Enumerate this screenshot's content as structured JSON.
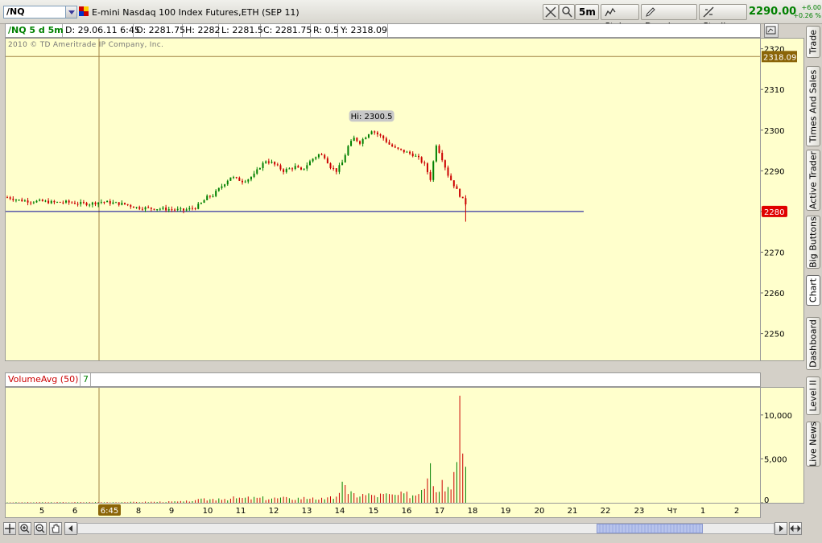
{
  "toolbar": {
    "symbol": "/NQ",
    "instrument_desc": "E-mini Nasdaq 100 Index Futures,ETH (SEP 11)",
    "timeframe_label": "5m",
    "style_label": "Style",
    "drawings_label": "Drawings",
    "studies_label": "Studies",
    "last_price": "2290.00",
    "change_abs": "+6.00",
    "change_pct": "+0.26 %"
  },
  "info_bar": {
    "symbol_period": "/NQ 5 d 5m",
    "date": "D: 29.06.11 6:45",
    "open": "O: 2281.75",
    "high": "H: 2282",
    "low": "L: 2281.5",
    "close": "C: 2281.75",
    "range": "R: 0.5",
    "y": "Y: 2318.09"
  },
  "copyright": "2010 © TD Ameritrade IP Company, Inc.",
  "volume_bar": {
    "study_label": "VolumeAvg (50)",
    "value": "7"
  },
  "side_tabs": [
    "Trade",
    "Times And Sales",
    "Active Trader",
    "Big Buttons",
    "Chart",
    "Dashboard",
    "Level II",
    "Live News"
  ],
  "colors": {
    "plot_bg": "#ffffcc",
    "up": "#008000",
    "down": "#cc0000",
    "hline": "#000099",
    "crosshair": "#a08040",
    "cursor_label_bg": "#8b6508",
    "price_marker": "#e00000"
  },
  "chart_data": {
    "type": "candlestick",
    "price_axis": {
      "ylim": [
        2243,
        2322.5
      ],
      "ticks": [
        2250,
        2260,
        2270,
        2280,
        2290,
        2300,
        2310,
        2320
      ]
    },
    "volume_axis": {
      "ylim": [
        0,
        12000
      ],
      "ticks": [
        "0",
        "5,000",
        "10,000"
      ]
    },
    "x_ticks": [
      "5",
      "6",
      "6:45",
      "8",
      "9",
      "10",
      "11",
      "12",
      "13",
      "14",
      "15",
      "16",
      "17",
      "18",
      "19",
      "20",
      "21",
      "22",
      "23",
      "Чт",
      "1",
      "2"
    ],
    "cursor_time_label": "6:45",
    "crosshair_price": "2318.09",
    "current_price_marker": "2280",
    "horizontal_line": 2280,
    "high_label": "Hi: 2300.5",
    "close_path": [
      [
        0,
        2283.5
      ],
      [
        4,
        2282.8
      ],
      [
        8,
        2282.5
      ],
      [
        12,
        2282.5
      ],
      [
        16,
        2282.2
      ],
      [
        20,
        2282.3
      ],
      [
        24,
        2282.0
      ],
      [
        28,
        2281.9
      ],
      [
        32,
        2282.4
      ],
      [
        36,
        2282.1
      ],
      [
        40,
        2281.8
      ],
      [
        44,
        2281.0
      ],
      [
        48,
        2280.8
      ],
      [
        52,
        2280.7
      ],
      [
        56,
        2280.5
      ],
      [
        60,
        2280.3
      ],
      [
        64,
        2281.0
      ],
      [
        66,
        2282.0
      ],
      [
        68,
        2283.5
      ],
      [
        70,
        2284.0
      ],
      [
        72,
        2285.5
      ],
      [
        74,
        2287.0
      ],
      [
        76,
        2288.5
      ],
      [
        78,
        2288.0
      ],
      [
        80,
        2287.5
      ],
      [
        82,
        2288.0
      ],
      [
        84,
        2289.0
      ],
      [
        86,
        2291.0
      ],
      [
        88,
        2292.5
      ],
      [
        90,
        2292.0
      ],
      [
        92,
        2291.0
      ],
      [
        94,
        2290.0
      ],
      [
        96,
        2290.5
      ],
      [
        98,
        2291.0
      ],
      [
        100,
        2290.0
      ],
      [
        102,
        2291.5
      ],
      [
        104,
        2293.0
      ],
      [
        106,
        2294.0
      ],
      [
        108,
        2293.5
      ],
      [
        110,
        2291.0
      ],
      [
        112,
        2290.0
      ],
      [
        114,
        2292.0
      ],
      [
        116,
        2296.0
      ],
      [
        118,
        2298.0
      ],
      [
        120,
        2297.0
      ],
      [
        122,
        2298.5
      ],
      [
        124,
        2300.0
      ],
      [
        126,
        2299.0
      ],
      [
        128,
        2298.0
      ],
      [
        130,
        2296.5
      ],
      [
        132,
        2295.5
      ],
      [
        134,
        2295.0
      ],
      [
        136,
        2294.5
      ],
      [
        138,
        2294.0
      ],
      [
        140,
        2293.0
      ],
      [
        142,
        2291.5
      ],
      [
        144,
        2288.0
      ],
      [
        146,
        2296.5
      ],
      [
        148,
        2293.0
      ],
      [
        150,
        2289.0
      ],
      [
        152,
        2286.5
      ],
      [
        154,
        2284.0
      ],
      [
        156,
        2281.75
      ]
    ],
    "volume": [
      [
        0,
        50
      ],
      [
        40,
        80
      ],
      [
        60,
        150
      ],
      [
        64,
        300
      ],
      [
        72,
        500
      ],
      [
        80,
        550
      ],
      [
        96,
        520
      ],
      [
        104,
        600
      ],
      [
        108,
        400
      ],
      [
        112,
        700
      ],
      [
        114,
        2400
      ],
      [
        116,
        1000
      ],
      [
        124,
        900
      ],
      [
        132,
        900
      ],
      [
        140,
        1000
      ],
      [
        144,
        4500
      ],
      [
        146,
        1200
      ],
      [
        148,
        2600
      ],
      [
        150,
        1800
      ],
      [
        152,
        3500
      ],
      [
        154,
        12200
      ],
      [
        156,
        4100
      ]
    ]
  }
}
